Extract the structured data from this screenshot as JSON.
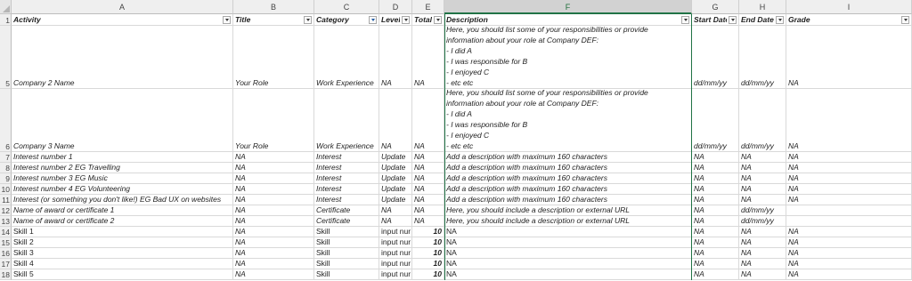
{
  "column_letters": [
    "A",
    "B",
    "C",
    "D",
    "E",
    "F",
    "G",
    "H",
    "I"
  ],
  "selected_column": "F",
  "header_row": {
    "row_number": "1",
    "cells": [
      "Activity",
      "Title",
      "Category",
      "Level",
      "Totals",
      "Description",
      "Start Date",
      "End Date",
      "Grade"
    ]
  },
  "rows": [
    {
      "n": "5",
      "activity": "Company 2 Name",
      "title": "Your Role",
      "category": "Work Experience",
      "level": "NA",
      "totals": "NA",
      "description_lines": [
        "Here, you should list some of your responsibilities or provide",
        "information about your role at Company DEF:",
        "- I did A",
        "- I was responsible for B",
        "- I enjoyed C",
        "- etc etc"
      ],
      "start": "dd/mm/yy",
      "end": "dd/mm/yy",
      "grade": "NA"
    },
    {
      "n": "6",
      "activity": "Company 3 Name",
      "title": "Your Role",
      "category": "Work Experience",
      "level": "NA",
      "totals": "NA",
      "description_lines": [
        "Here, you should list some of your responsibilities or provide",
        "information about your role at Company DEF:",
        "- I did A",
        "- I was responsible for B",
        "- I enjoyed C",
        "- etc etc"
      ],
      "start": "dd/mm/yy",
      "end": "dd/mm/yy",
      "grade": "NA"
    },
    {
      "n": "7",
      "activity": "Interest number 1",
      "title": "NA",
      "category": "Interest",
      "level": "Update",
      "totals": "NA",
      "description": "Add a description with maximum 160 characters",
      "start": "NA",
      "end": "NA",
      "grade": "NA"
    },
    {
      "n": "8",
      "activity": "Interest number 2 EG Travelling",
      "title": "NA",
      "category": "Interest",
      "level": "Update",
      "totals": "NA",
      "description": "Add a description with maximum 160 characters",
      "start": "NA",
      "end": "NA",
      "grade": "NA"
    },
    {
      "n": "9",
      "activity": "Interest number 3 EG Music",
      "title": "NA",
      "category": "Interest",
      "level": "Update",
      "totals": "NA",
      "description": "Add a description with maximum 160 characters",
      "start": "NA",
      "end": "NA",
      "grade": "NA"
    },
    {
      "n": "10",
      "activity": "Interest number 4 EG Volunteering",
      "title": "NA",
      "category": "Interest",
      "level": "Update",
      "totals": "NA",
      "description": "Add a description with maximum 160 characters",
      "start": "NA",
      "end": "NA",
      "grade": "NA"
    },
    {
      "n": "11",
      "activity": "Interest (or something you don't like!) EG Bad UX on websites",
      "title": "NA",
      "category": "Interest",
      "level": "Update",
      "totals": "NA",
      "description": "Add a description with maximum 160 characters",
      "start": "NA",
      "end": "NA",
      "grade": "NA"
    },
    {
      "n": "12",
      "activity": "Name of award or certificate 1",
      "title": "NA",
      "category": "Certificate",
      "level": "NA",
      "totals": "NA",
      "description": "Here, you should include a description or external URL",
      "start": "NA",
      "end": "dd/mm/yy",
      "grade": ""
    },
    {
      "n": "13",
      "activity": "Name of award or certificate 2",
      "title": "NA",
      "category": "Certificate",
      "level": "NA",
      "totals": "NA",
      "description": "Here, you should include a description or external URL",
      "start": "NA",
      "end": "dd/mm/yy",
      "grade": ""
    },
    {
      "n": "14",
      "activity": "Skill 1",
      "title": "NA",
      "category": "Skill",
      "level": "input nur",
      "totals": "10",
      "description": "NA",
      "start": "NA",
      "end": "NA",
      "grade": "NA"
    },
    {
      "n": "15",
      "activity": "Skill 2",
      "title": "NA",
      "category": "Skill",
      "level": "input nur",
      "totals": "10",
      "description": "NA",
      "start": "NA",
      "end": "NA",
      "grade": "NA"
    },
    {
      "n": "16",
      "activity": "Skill 3",
      "title": "NA",
      "category": "Skill",
      "level": "input nur",
      "totals": "10",
      "description": "NA",
      "start": "NA",
      "end": "NA",
      "grade": "NA"
    },
    {
      "n": "17",
      "activity": "Skill 4",
      "title": "NA",
      "category": "Skill",
      "level": "input nur",
      "totals": "10",
      "description": "NA",
      "start": "NA",
      "end": "NA",
      "grade": "NA"
    },
    {
      "n": "18",
      "activity": "Skill 5",
      "title": "NA",
      "category": "Skill",
      "level": "input nur",
      "totals": "10",
      "description": "NA",
      "start": "NA",
      "end": "NA",
      "grade": "NA"
    }
  ],
  "filter_icons": [
    "filter-dropdown-icon",
    "filter-active-icon"
  ],
  "colors": {
    "accent": "#217346",
    "grid": "#d9d9d9",
    "header_bg": "#efefef"
  }
}
